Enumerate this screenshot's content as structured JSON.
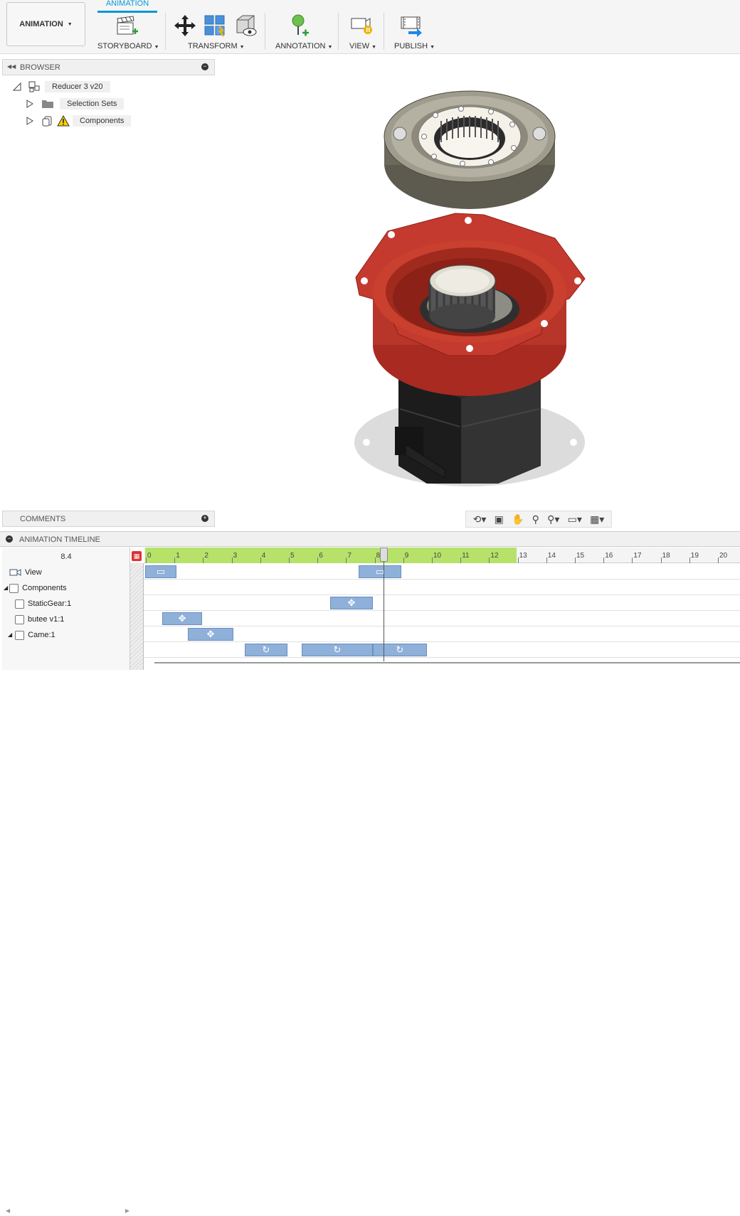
{
  "toolbar": {
    "workspace_label": "ANIMATION",
    "active_tab": "ANIMATION",
    "groups": {
      "storyboard": "STORYBOARD",
      "transform": "TRANSFORM",
      "annotation": "ANNOTATION",
      "view": "VIEW",
      "publish": "PUBLISH"
    }
  },
  "browser": {
    "title": "BROWSER",
    "root": "Reducer 3 v20",
    "items": [
      {
        "label": "Selection Sets",
        "icon": "folder-icon"
      },
      {
        "label": "Components",
        "icon": "warning-icon"
      }
    ]
  },
  "comments": {
    "title": "COMMENTS"
  },
  "timeline": {
    "title": "ANIMATION TIMELINE",
    "current_time": "8.4",
    "ticks": [
      "0",
      "1",
      "2",
      "3",
      "4",
      "5",
      "6",
      "7",
      "8",
      "9",
      "10",
      "11",
      "12",
      "13",
      "14",
      "15",
      "16",
      "17",
      "18",
      "19",
      "20"
    ],
    "rows": [
      "View",
      "Components",
      "StaticGear:1",
      "butee v1:1",
      "Came:1"
    ]
  },
  "colors": {
    "accent": "#0696d7",
    "keyframe": "#8fb0d9",
    "ruler_active": "#b6e26a",
    "housing": "#c0392b"
  }
}
